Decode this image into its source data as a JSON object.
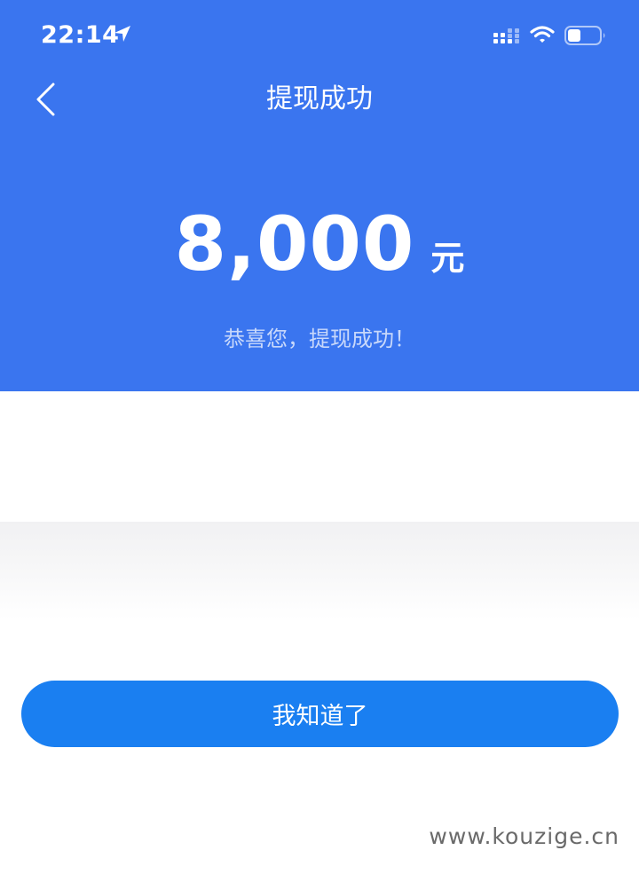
{
  "status_bar": {
    "time": "22:14",
    "icons": [
      "location-arrow-icon",
      "cellular-signal-icon",
      "wifi-icon",
      "battery-icon"
    ]
  },
  "nav": {
    "back_icon": "chevron-left-icon",
    "title": "提现成功"
  },
  "result": {
    "amount": "8,000",
    "unit": "元",
    "message": "恭喜您，提现成功！"
  },
  "actions": {
    "ok_label": "我知道了"
  },
  "watermark": "www.kouzige.cn",
  "colors": {
    "header_blue": "#3a75ef",
    "button_blue": "#1a7ff1"
  }
}
